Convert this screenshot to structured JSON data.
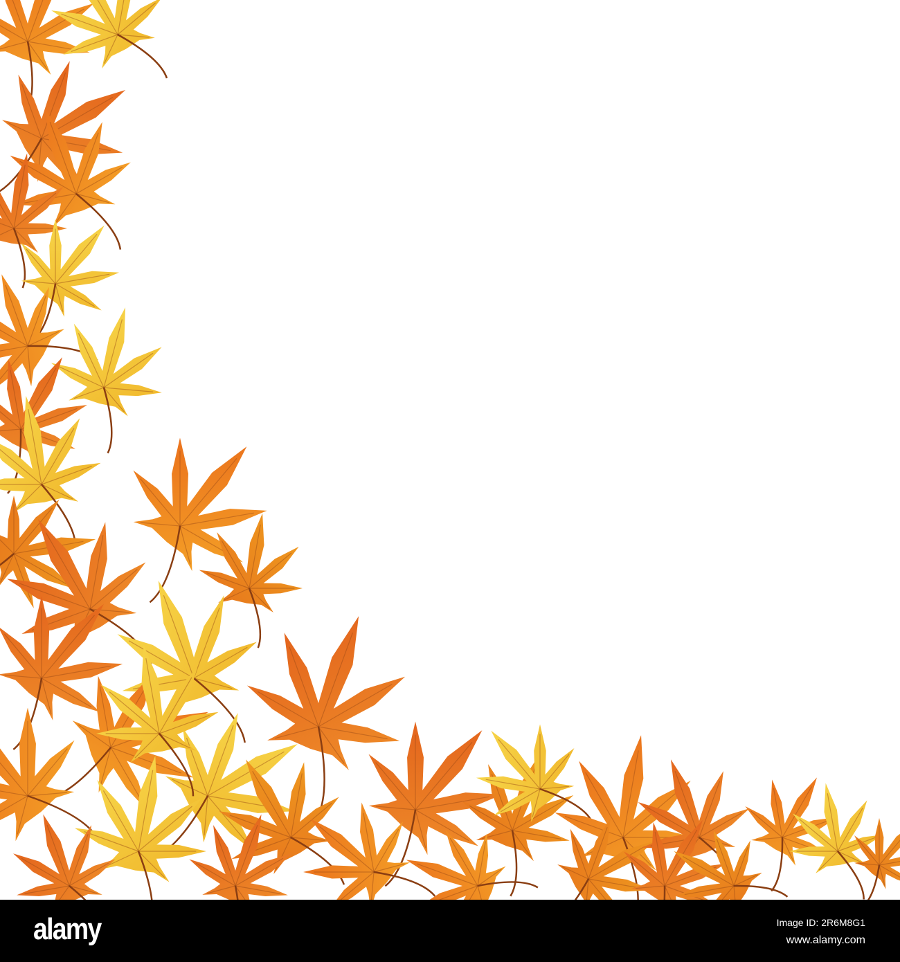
{
  "watermark": {
    "logo": "alamy",
    "image_id": "Image ID: 2R6M8G1",
    "website": "www.alamy.com"
  },
  "colors": {
    "red_orange": "#d9501a",
    "orange": "#ec7a1c",
    "amber": "#f39b22",
    "yellow": "#f5c930",
    "pale_yellow": "#f8de55",
    "vein": "#9a4a16",
    "footer": "#000000"
  }
}
